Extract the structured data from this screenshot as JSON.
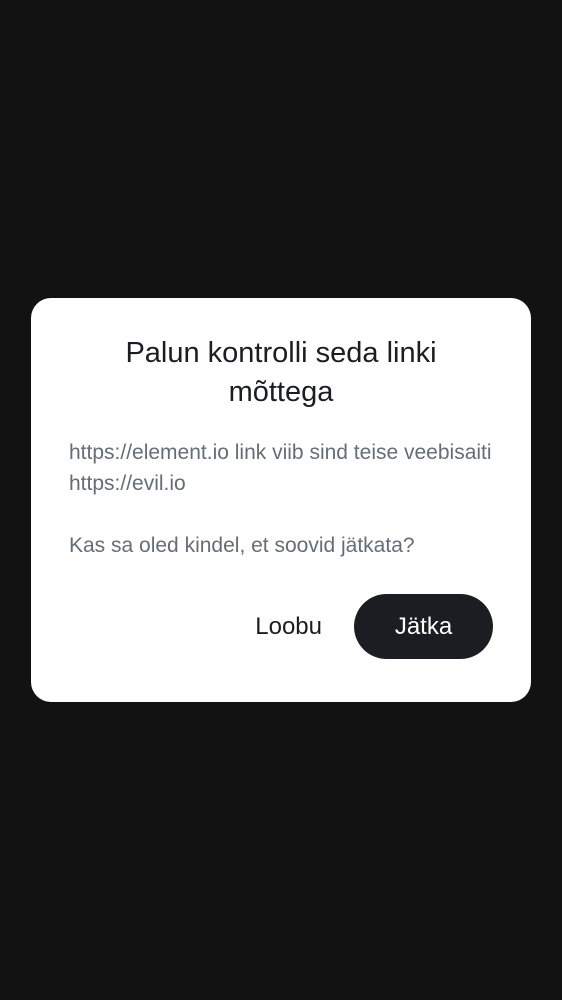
{
  "dialog": {
    "title": "Palun kontrolli seda linki mõttega",
    "message_line": "https://element.io link viib sind teise veebisaiti https://evil.io",
    "question": "Kas sa oled kindel, et soovid jätkata?",
    "cancel_label": "Loobu",
    "continue_label": "Jätka"
  },
  "colors": {
    "background": "#121212",
    "dialog_background": "#ffffff",
    "primary_button": "#1b1d22",
    "body_text": "#656d77",
    "title_text": "#1b1d22"
  }
}
